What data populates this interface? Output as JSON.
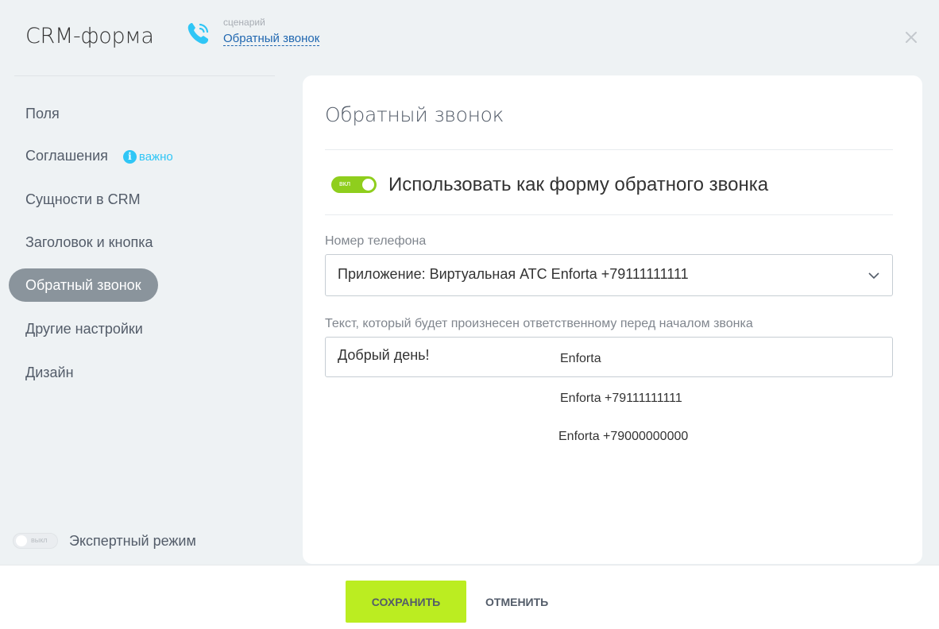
{
  "header": {
    "title": "CRM-форма",
    "scenario_caption": "сценарий",
    "scenario_link": "Обратный звонок"
  },
  "sidebar": {
    "items": [
      {
        "label": "Поля"
      },
      {
        "label": "Соглашения",
        "badge": "важно"
      },
      {
        "label": "Сущности в CRM"
      },
      {
        "label": "Заголовок и кнопка"
      },
      {
        "label": "Обратный звонок",
        "active": true
      },
      {
        "label": "Другие настройки"
      },
      {
        "label": "Дизайн"
      }
    ],
    "expert_toggle_label": "выкл",
    "expert_mode_label": "Экспертный режим"
  },
  "main": {
    "title": "Обратный звонок",
    "callback_toggle_label": "вкл",
    "use_as_callback_label": "Использовать как форму обратного звонка",
    "phone_label": "Номер телефона",
    "phone_select_value": "Приложение: Виртуальная АТС Enforta +79111111111",
    "speech_label": "Текст, который будет произнесен ответственному перед началом звонка",
    "speech_value": "Добрый день!",
    "dropdown_options": [
      "Enforta",
      "Enforta +79111111111",
      "Enforta +79000000000"
    ]
  },
  "footer": {
    "save_label": "СОХРАНИТЬ",
    "cancel_label": "ОТМЕНИТЬ"
  },
  "colors": {
    "accent_green": "#bbed21",
    "toggle_on": "#8fce1d",
    "link_blue": "#2067b0",
    "info_blue": "#2fc6f6",
    "active_item_bg": "#8a949c"
  }
}
